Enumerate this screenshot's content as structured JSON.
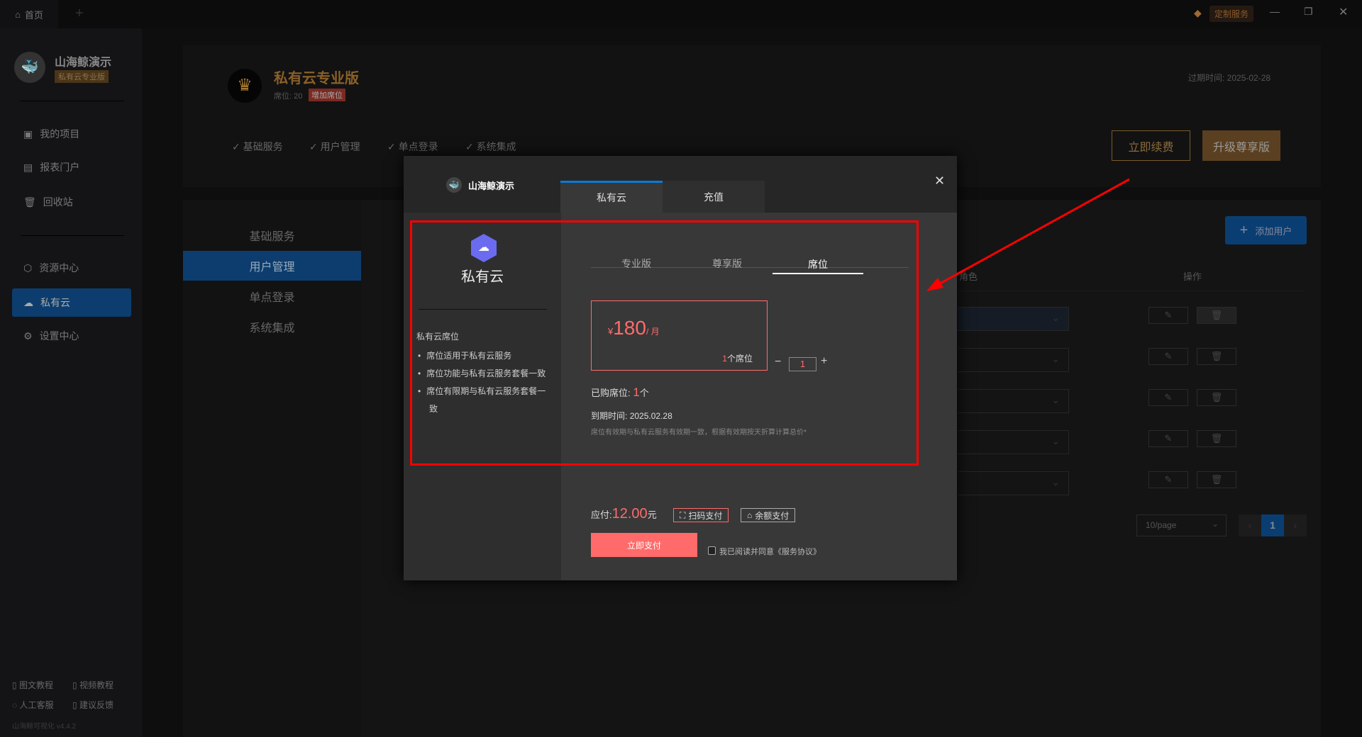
{
  "topbar": {
    "home_tab": "首页",
    "new_tab": "+",
    "custom_service": "定制服务"
  },
  "sidebar": {
    "user_name": "山海鲸演示",
    "badge": "私有云专业版",
    "items": [
      {
        "label": "我的项目",
        "icon": "chart-icon"
      },
      {
        "label": "报表门户",
        "icon": "report-icon"
      },
      {
        "label": "回收站",
        "icon": "trash-icon"
      },
      {
        "label": "资源中心",
        "icon": "resource-icon"
      },
      {
        "label": "私有云",
        "icon": "cloud-icon"
      },
      {
        "label": "设置中心",
        "icon": "gear-icon"
      }
    ],
    "footer": {
      "tutorial_text": "图文教程",
      "tutorial_video": "视频教程",
      "support": "人工客服",
      "feedback": "建议反馈",
      "version": "山海鲸可视化 v4.4.2"
    }
  },
  "plan": {
    "title": "私有云专业版",
    "seats": "席位: 20",
    "add_seats": "增加席位",
    "expire": "过期时间: 2025-02-28",
    "renew": "立即续费",
    "upgrade": "升级尊享版",
    "features": [
      "基础服务",
      "用户管理",
      "单点登录",
      "系统集成"
    ]
  },
  "menu": {
    "items": [
      "基础服务",
      "用户管理",
      "单点登录",
      "系统集成"
    ],
    "active": 1
  },
  "table": {
    "add_user": "添加用户",
    "col_role": "角色",
    "col_ops": "操作",
    "rows": 5,
    "page_size": "10/page",
    "page": "1"
  },
  "modal": {
    "brand": "山海鲸演示",
    "tabs": [
      "私有云",
      "充值"
    ],
    "active_tab": 0,
    "left": {
      "title": "私有云",
      "section": "私有云席位",
      "bullets": [
        "席位适用于私有云服务",
        "席位功能与私有云服务套餐一致",
        "席位有限期与私有云服务套餐一致"
      ]
    },
    "sub_tabs": [
      "专业版",
      "尊享版",
      "席位"
    ],
    "active_sub_tab": 2,
    "price": {
      "currency": "¥",
      "amount": "180",
      "unit": "/ 月",
      "seat_num": "1",
      "seat_label": "个席位"
    },
    "stepper": {
      "minus": "−",
      "value": "1",
      "plus": "+"
    },
    "purchased_label": "已购席位:",
    "purchased_value": "1",
    "purchased_unit": "个",
    "expire_label": "到期时间:",
    "expire_value": "2025.02.28",
    "note": "席位有效期与私有云服务有效期一致，根据有效期按天折算计算总价*",
    "due_label": "应付:",
    "due_amount": "12.00",
    "due_unit": "元",
    "pay_qr": "扫码支付",
    "pay_balance": "余额支付",
    "pay_now": "立即支付",
    "agree": "我已阅读并同意《服务协议》"
  },
  "colors": {
    "accent": "#ff6b6b",
    "blue": "#0a7bd6",
    "gold": "#b5823a",
    "annotation": "#ff0000"
  }
}
